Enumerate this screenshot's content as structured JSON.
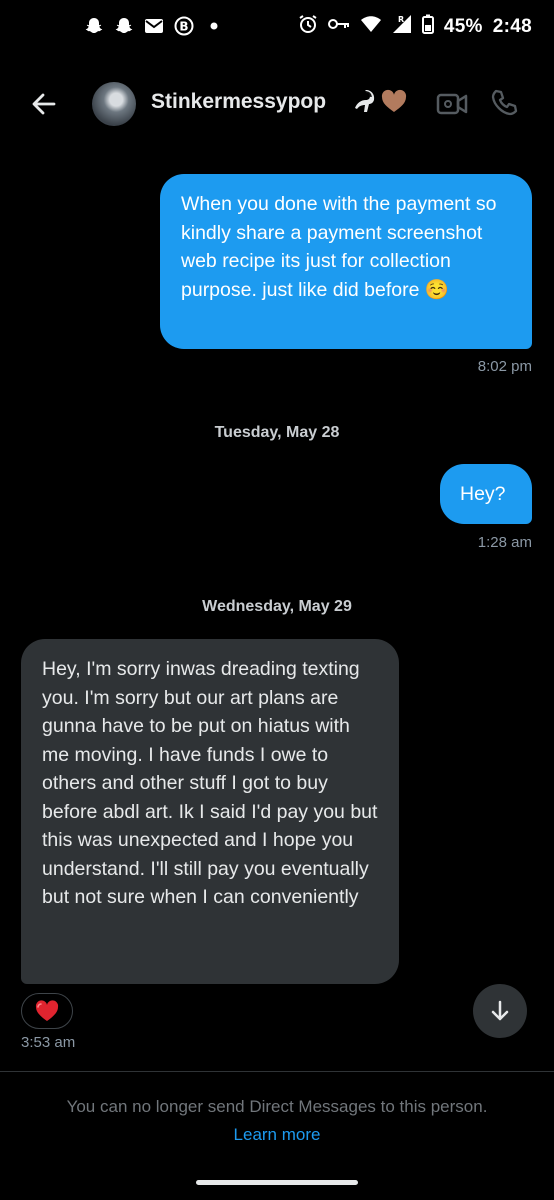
{
  "status_bar": {
    "battery": "45%",
    "time": "2:48",
    "icons_left": [
      "snapchat-icon",
      "snapchat-icon",
      "gmail-icon",
      "bitcoin-icon",
      "dot-icon"
    ],
    "icons_right": [
      "alarm-icon",
      "vpn-key-icon",
      "wifi-icon",
      "signal-icon",
      "battery-icon"
    ]
  },
  "header": {
    "contact_name": "Stinkermessypop",
    "name_emojis": "🦨🤎",
    "back_icon": "arrow-left-icon",
    "video_icon": "video-call-icon",
    "call_icon": "phone-icon"
  },
  "messages": [
    {
      "direction": "outgoing",
      "text": "When you done with the payment so kindly share a payment screenshot web recipe its just for collection purpose. just like did before ☺️",
      "time": "8:02 pm"
    },
    {
      "type": "date",
      "label": "Tuesday, May 28"
    },
    {
      "direction": "outgoing",
      "text": "Hey?",
      "time": "1:28 am"
    },
    {
      "type": "date",
      "label": "Wednesday, May 29"
    },
    {
      "direction": "incoming",
      "text": "Hey, I'm sorry inwas dreading texting you. I'm sorry but our art plans are gunna have to be put on hiatus with me moving. I have funds I owe to others and other stuff I got to buy before abdl art. Ik I said I'd pay you but this was unexpected and I hope you understand. I'll still pay you eventually but not sure when I can conveniently",
      "reaction": "❤️",
      "time": "3:53 am"
    }
  ],
  "footer": {
    "notice": "You can no longer send Direct Messages to this person.",
    "link": "Learn more"
  },
  "colors": {
    "background": "#000000",
    "outgoing_bubble": "#1d9bf0",
    "incoming_bubble": "#2f3336",
    "link": "#1d9bf0",
    "muted_text": "#71767b"
  }
}
